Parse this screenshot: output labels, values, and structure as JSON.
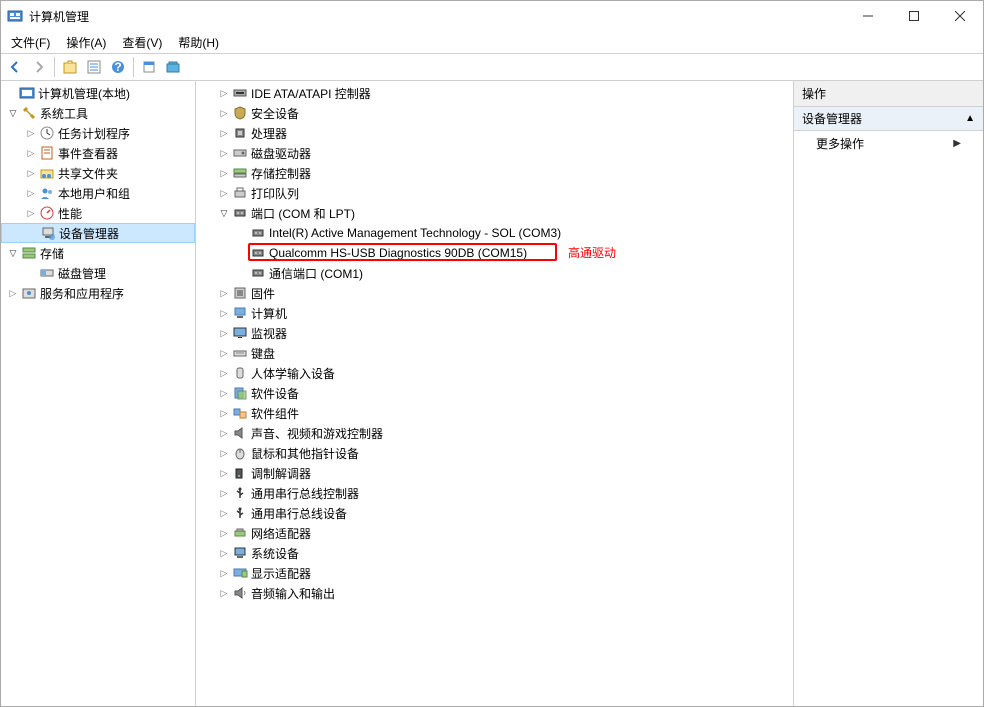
{
  "window": {
    "title": "计算机管理"
  },
  "menu": {
    "file": "文件(F)",
    "action": "操作(A)",
    "view": "查看(V)",
    "help": "帮助(H)"
  },
  "actions_panel": {
    "header": "操作",
    "section": "设备管理器",
    "more": "更多操作"
  },
  "left_tree": {
    "root": "计算机管理(本地)",
    "systools": "系统工具",
    "taskscheduler": "任务计划程序",
    "eventviewer": "事件查看器",
    "sharedfolders": "共享文件夹",
    "localusers": "本地用户和组",
    "performance": "性能",
    "devicemgr": "设备管理器",
    "storage": "存储",
    "diskmgmt": "磁盘管理",
    "services": "服务和应用程序"
  },
  "device_tree": {
    "ide": "IDE ATA/ATAPI 控制器",
    "security": "安全设备",
    "processors": "处理器",
    "diskdrives": "磁盘驱动器",
    "storagectl": "存储控制器",
    "printqueues": "打印队列",
    "ports": "端口 (COM 和 LPT)",
    "port_intel": "Intel(R) Active Management Technology - SOL (COM3)",
    "port_qualcomm": "Qualcomm HS-USB Diagnostics 90DB (COM15)",
    "port_comm": "通信端口 (COM1)",
    "firmware": "固件",
    "computer": "计算机",
    "monitors": "监视器",
    "keyboards": "键盘",
    "hid": "人体学输入设备",
    "software": "软件设备",
    "swcomponents": "软件组件",
    "sound": "声音、视频和游戏控制器",
    "mice": "鼠标和其他指针设备",
    "modems": "调制解调器",
    "usbctl": "通用串行总线控制器",
    "usbdev": "通用串行总线设备",
    "network": "网络适配器",
    "sysdevices": "系统设备",
    "display": "显示适配器",
    "audio": "音频输入和输出"
  },
  "annotation": {
    "label": "高通驱动"
  }
}
